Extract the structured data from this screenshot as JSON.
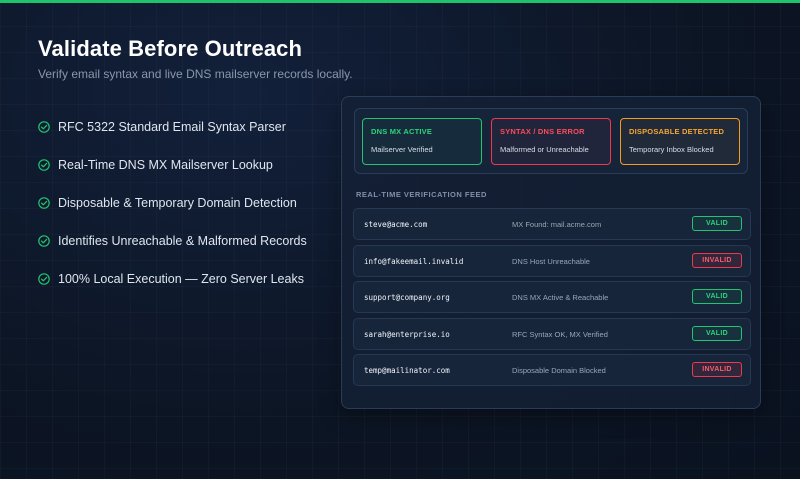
{
  "hero": {
    "title": "Validate Before Outreach",
    "subtitle": "Verify email syntax and live DNS mailserver records locally."
  },
  "features": [
    {
      "label": "RFC 5322 Standard Email Syntax Parser",
      "icon": "check-circle-icon"
    },
    {
      "label": "Real-Time DNS MX Mailserver Lookup",
      "icon": "check-circle-icon"
    },
    {
      "label": "Disposable & Temporary Domain Detection",
      "icon": "check-circle-icon"
    },
    {
      "label": "Identifies Unreachable & Malformed Records",
      "icon": "check-circle-icon"
    },
    {
      "label": "100% Local Execution — Zero Server Leaks",
      "icon": "check-circle-icon"
    }
  ],
  "status_cards": [
    {
      "title": "DNS MX ACTIVE",
      "description": "Mailserver Verified",
      "color": "#22c46f"
    },
    {
      "title": "SYNTAX / DNS ERROR",
      "description": "Malformed or Unreachable",
      "color": "#f0384d"
    },
    {
      "title": "DISPOSABLE DETECTED",
      "description": "Temporary Inbox Blocked",
      "color": "#f59a23"
    }
  ],
  "feed": {
    "label": "REAL-TIME VERIFICATION FEED",
    "rows": [
      {
        "email": "steve@acme.com",
        "detail": "MX Found: mail.acme.com",
        "status": "VALID"
      },
      {
        "email": "info@fakeemail.invalid",
        "detail": "DNS Host Unreachable",
        "status": "INVALID"
      },
      {
        "email": "support@company.org",
        "detail": "DNS MX Active & Reachable",
        "status": "VALID"
      },
      {
        "email": "sarah@enterprise.io",
        "detail": "RFC Syntax OK, MX Verified",
        "status": "VALID"
      },
      {
        "email": "temp@mailinator.com",
        "detail": "Disposable Domain Blocked",
        "status": "INVALID"
      }
    ]
  },
  "colors": {
    "accent_green": "#1fc46a",
    "valid": "#22c46f",
    "invalid": "#f0384d",
    "disposable": "#f59a23",
    "background": "#0c1524"
  }
}
